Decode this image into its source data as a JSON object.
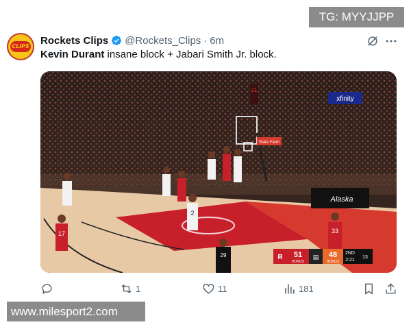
{
  "watermarks": {
    "top": "TG: MYYJJPP",
    "bottom": "www.milesport2.com"
  },
  "tweet": {
    "avatar_text": "CLIPS",
    "display_name": "Rockets Clips",
    "handle": "@Rockets_Clips",
    "separator": "·",
    "time": "6m",
    "text_bold": "Kevin Durant",
    "text_rest": " insane block + Jabari Smith Jr. block."
  },
  "media": {
    "sponsor_top": "xfinity",
    "sponsor_mid": "State Farm",
    "court_logo": "Alaska",
    "shot_clock": "21",
    "player_numbers": [
      "17",
      "2",
      "33",
      "29"
    ],
    "scoreboard": {
      "home_score": "51",
      "home_tag": "BONUS",
      "away_score": "48",
      "away_tag": "BONUS",
      "quarter": "2ND",
      "game_clock": "2:21",
      "shot_clock": "13"
    }
  },
  "actions": {
    "reply": {
      "icon": "reply-icon",
      "count": ""
    },
    "retweet": {
      "icon": "retweet-icon",
      "count": "1"
    },
    "like": {
      "icon": "heart-icon",
      "count": "11"
    },
    "views": {
      "icon": "views-icon",
      "count": "181"
    },
    "bookmark": {
      "icon": "bookmark-icon"
    },
    "share": {
      "icon": "share-icon"
    }
  },
  "colors": {
    "accent": "#1d9bf0",
    "muted": "#536471",
    "text": "#0f1419",
    "court_red": "#c8202b"
  }
}
